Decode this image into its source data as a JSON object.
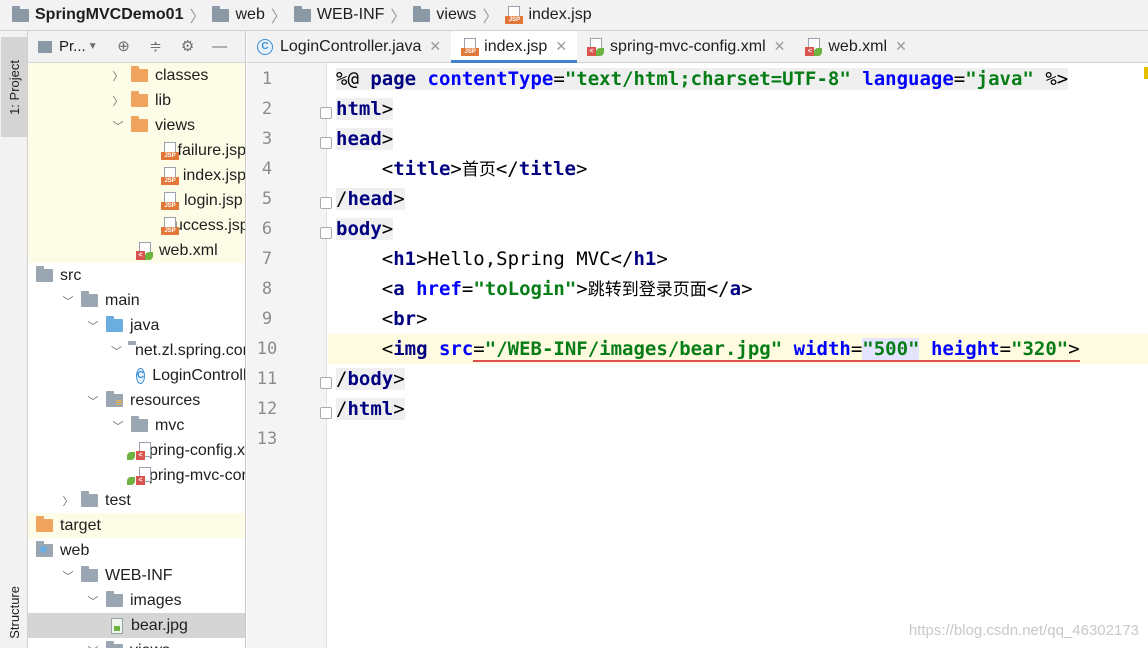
{
  "breadcrumb": [
    {
      "label": "SpringMVCDemo01",
      "icon": "project-folder-icon",
      "bold": true
    },
    {
      "label": "web",
      "icon": "folder-icon"
    },
    {
      "label": "WEB-INF",
      "icon": "folder-icon"
    },
    {
      "label": "views",
      "icon": "folder-icon"
    },
    {
      "label": "index.jsp",
      "icon": "jsp-file-icon"
    }
  ],
  "side_strip": {
    "project_tab": "1: Project",
    "structure_tab": "Structure"
  },
  "project_panel": {
    "title": "Pr...",
    "toolbar_icons": [
      "locate-icon",
      "collapse-icon",
      "gear-icon",
      "minimize-icon"
    ]
  },
  "tree": [
    {
      "label": "classes",
      "indent": 3,
      "arrow": "right",
      "icon": "folder-orange",
      "bg": "yellow"
    },
    {
      "label": "lib",
      "indent": 3,
      "arrow": "right",
      "icon": "folder-orange",
      "bg": "yellow"
    },
    {
      "label": "views",
      "indent": 3,
      "arrow": "down",
      "icon": "folder-orange",
      "bg": "yellow"
    },
    {
      "label": "failure.jsp",
      "indent": 5,
      "arrow": "none",
      "icon": "jsp",
      "bg": "yellow"
    },
    {
      "label": "index.jsp",
      "indent": 5,
      "arrow": "none",
      "icon": "jsp",
      "bg": "yellow"
    },
    {
      "label": "login.jsp",
      "indent": 5,
      "arrow": "none",
      "icon": "jsp",
      "bg": "yellow"
    },
    {
      "label": "success.jsp",
      "indent": 5,
      "arrow": "none",
      "icon": "jsp",
      "bg": "yellow"
    },
    {
      "label": "web.xml",
      "indent": 4,
      "arrow": "none",
      "icon": "xml",
      "bg": "yellow"
    },
    {
      "label": "src",
      "indent": 0,
      "arrow": "none",
      "icon": "folder",
      "bg": ""
    },
    {
      "label": "main",
      "indent": 1,
      "arrow": "down",
      "icon": "folder",
      "bg": ""
    },
    {
      "label": "java",
      "indent": 2,
      "arrow": "down",
      "icon": "folder-blue",
      "bg": ""
    },
    {
      "label": "net.zl.spring.controller",
      "indent": 3,
      "arrow": "down",
      "icon": "package",
      "bg": ""
    },
    {
      "label": "LoginController",
      "indent": 4,
      "arrow": "none",
      "icon": "class",
      "bg": ""
    },
    {
      "label": "resources",
      "indent": 2,
      "arrow": "down",
      "icon": "resources",
      "bg": ""
    },
    {
      "label": "mvc",
      "indent": 3,
      "arrow": "down",
      "icon": "folder",
      "bg": ""
    },
    {
      "label": "spring-config.xml",
      "indent": 4,
      "arrow": "none",
      "icon": "xml",
      "bg": ""
    },
    {
      "label": "spring-mvc-config.xml",
      "indent": 4,
      "arrow": "none",
      "icon": "xml",
      "bg": ""
    },
    {
      "label": "test",
      "indent": 1,
      "arrow": "right",
      "icon": "folder",
      "bg": ""
    },
    {
      "label": "target",
      "indent": 0,
      "arrow": "none",
      "icon": "folder-orange",
      "bg": "yellow"
    },
    {
      "label": "web",
      "indent": 0,
      "arrow": "none",
      "icon": "web",
      "bg": ""
    },
    {
      "label": "WEB-INF",
      "indent": 1,
      "arrow": "down",
      "icon": "folder",
      "bg": ""
    },
    {
      "label": "images",
      "indent": 2,
      "arrow": "down",
      "icon": "folder",
      "bg": ""
    },
    {
      "label": "bear.jpg",
      "indent": 3,
      "arrow": "none",
      "icon": "image",
      "bg": "selected"
    },
    {
      "label": "views",
      "indent": 2,
      "arrow": "down",
      "icon": "folder",
      "bg": ""
    }
  ],
  "editor_tabs": [
    {
      "label": "LoginController.java",
      "icon": "class",
      "active": false
    },
    {
      "label": "index.jsp",
      "icon": "jsp",
      "active": true
    },
    {
      "label": "spring-mvc-config.xml",
      "icon": "xml",
      "active": false
    },
    {
      "label": "web.xml",
      "icon": "xml",
      "active": false
    }
  ],
  "line_numbers": [
    "1",
    "2",
    "3",
    "4",
    "5",
    "6",
    "7",
    "8",
    "9",
    "10",
    "11",
    "12",
    "13"
  ],
  "code_lines": [
    [
      {
        "c": "d",
        "t": "%@ "
      },
      {
        "c": "t",
        "t": "page "
      },
      {
        "c": "a",
        "t": "contentType"
      },
      {
        "c": "d",
        "t": "="
      },
      {
        "c": "s",
        "t": "\"text/html;charset=UTF-8\""
      },
      {
        "c": "d",
        "t": " "
      },
      {
        "c": "a",
        "t": "language"
      },
      {
        "c": "d",
        "t": "="
      },
      {
        "c": "s",
        "t": "\"java\""
      },
      {
        "c": "d",
        "t": " %>"
      }
    ],
    [
      {
        "c": "t",
        "t": "html"
      },
      {
        "c": "d",
        "t": ">"
      }
    ],
    [
      {
        "c": "t",
        "t": "head"
      },
      {
        "c": "d",
        "t": ">"
      }
    ],
    [
      {
        "c": "d",
        "t": "    <"
      },
      {
        "c": "t",
        "t": "title"
      },
      {
        "c": "d",
        "t": ">"
      },
      {
        "c": "cjk",
        "t": "首页"
      },
      {
        "c": "d",
        "t": "</"
      },
      {
        "c": "t",
        "t": "title"
      },
      {
        "c": "d",
        "t": ">"
      }
    ],
    [
      {
        "c": "d",
        "t": "/"
      },
      {
        "c": "t",
        "t": "head"
      },
      {
        "c": "d",
        "t": ">"
      }
    ],
    [
      {
        "c": "t",
        "t": "body"
      },
      {
        "c": "d",
        "t": ">"
      }
    ],
    [
      {
        "c": "d",
        "t": "    <"
      },
      {
        "c": "t",
        "t": "h1"
      },
      {
        "c": "d",
        "t": ">Hello,Spring MVC</"
      },
      {
        "c": "t",
        "t": "h1"
      },
      {
        "c": "d",
        "t": ">"
      }
    ],
    [
      {
        "c": "d",
        "t": "    <"
      },
      {
        "c": "t",
        "t": "a "
      },
      {
        "c": "a",
        "t": "href"
      },
      {
        "c": "d",
        "t": "="
      },
      {
        "c": "s",
        "t": "\"toLogin\""
      },
      {
        "c": "d",
        "t": ">"
      },
      {
        "c": "cjk",
        "t": "跳转到登录页面"
      },
      {
        "c": "d",
        "t": "</"
      },
      {
        "c": "t",
        "t": "a"
      },
      {
        "c": "d",
        "t": ">"
      }
    ],
    [
      {
        "c": "d",
        "t": "    <"
      },
      {
        "c": "t",
        "t": "br"
      },
      {
        "c": "d",
        "t": ">"
      }
    ],
    [
      {
        "c": "d",
        "t": "    <"
      },
      {
        "c": "t",
        "t": "img "
      },
      {
        "c": "a",
        "t": "src"
      },
      {
        "c": "d",
        "t": "="
      },
      {
        "c": "s",
        "t": "\"/WEB-INF/images/bear.jpg\""
      },
      {
        "c": "d",
        "t": " "
      },
      {
        "c": "a",
        "t": "width"
      },
      {
        "c": "d",
        "t": "="
      },
      {
        "c": "s",
        "t": "\"500\""
      },
      {
        "c": "d",
        "t": " "
      },
      {
        "c": "a",
        "t": "height"
      },
      {
        "c": "d",
        "t": "="
      },
      {
        "c": "s",
        "t": "\"320\""
      },
      {
        "c": "d",
        "t": ">"
      }
    ],
    [
      {
        "c": "d",
        "t": "/"
      },
      {
        "c": "t",
        "t": "body"
      },
      {
        "c": "d",
        "t": ">"
      }
    ],
    [
      {
        "c": "d",
        "t": "/"
      },
      {
        "c": "t",
        "t": "html"
      },
      {
        "c": "d",
        "t": ">"
      }
    ],
    []
  ],
  "caret_line": 10,
  "watermark": "https://blog.csdn.net/qq_46302173"
}
